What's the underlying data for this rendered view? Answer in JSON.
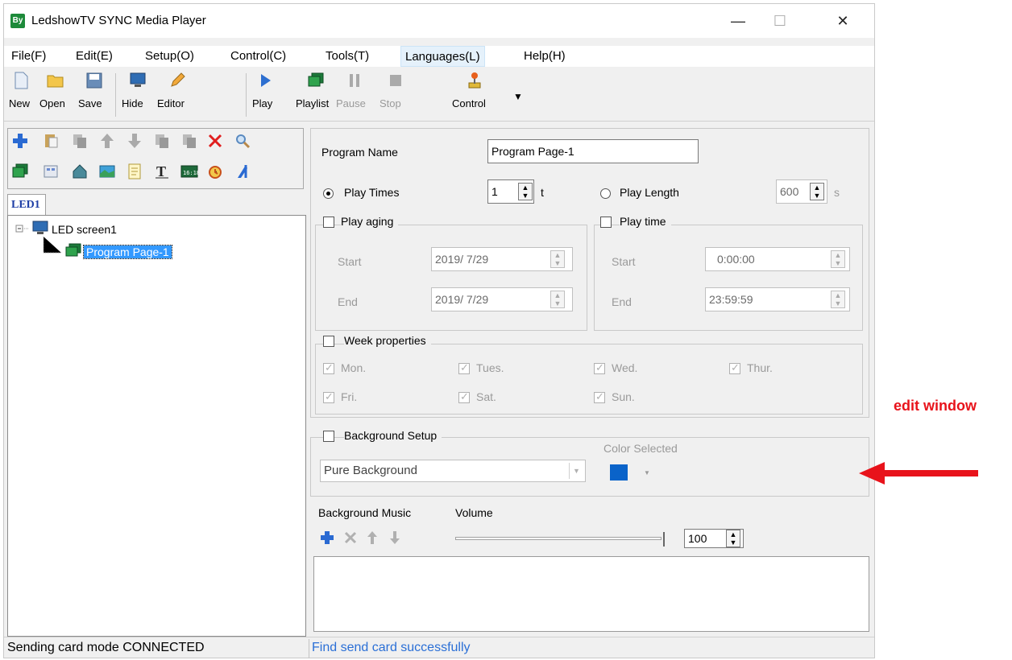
{
  "window": {
    "title": "LedshowTV SYNC Media Player",
    "app_icon_text": "By",
    "minimize": "—",
    "maximize": "☐",
    "close": "✕"
  },
  "menu": [
    "File(F)",
    "Edit(E)",
    "Setup(O)",
    "Control(C)",
    "Tools(T)",
    "Languages(L)",
    "Help(H)"
  ],
  "toolbar": {
    "new": "New",
    "open": "Open",
    "save": "Save",
    "hide": "Hide",
    "editor": "Editor",
    "play": "Play",
    "playlist": "Playlist",
    "pause": "Pause",
    "stop": "Stop",
    "control": "Control"
  },
  "left": {
    "tab": "LED1",
    "tree_root": "LED screen1",
    "tree_child": "Program Page-1"
  },
  "program": {
    "name_label": "Program Name",
    "name_value": "Program Page-1",
    "play_times_label": "Play Times",
    "play_times_value": "1",
    "play_times_unit": "t",
    "play_length_label": "Play Length",
    "play_length_value": "600",
    "play_length_unit": "s"
  },
  "aging": {
    "label": "Play aging",
    "start_label": "Start",
    "start_value": "2019/ 7/29",
    "end_label": "End",
    "end_value": "2019/ 7/29"
  },
  "playtime": {
    "label": "Play time",
    "start_label": "Start",
    "start_value": "0:00:00",
    "end_label": "End",
    "end_value": "23:59:59"
  },
  "week": {
    "label": "Week properties",
    "days": [
      "Mon.",
      "Tues.",
      "Wed.",
      "Thur.",
      "Fri.",
      "Sat.",
      "Sun."
    ]
  },
  "background": {
    "label": "Background Setup",
    "type_value": "Pure Background",
    "color_label": "Color Selected",
    "color": "#0a63c9"
  },
  "music": {
    "label": "Background Music",
    "volume_label": "Volume",
    "volume_value": "100"
  },
  "status": {
    "left": "Sending card mode CONNECTED",
    "right": "Find send card successfully"
  },
  "annotation": {
    "text": "edit window",
    "color": "#e8131b"
  }
}
